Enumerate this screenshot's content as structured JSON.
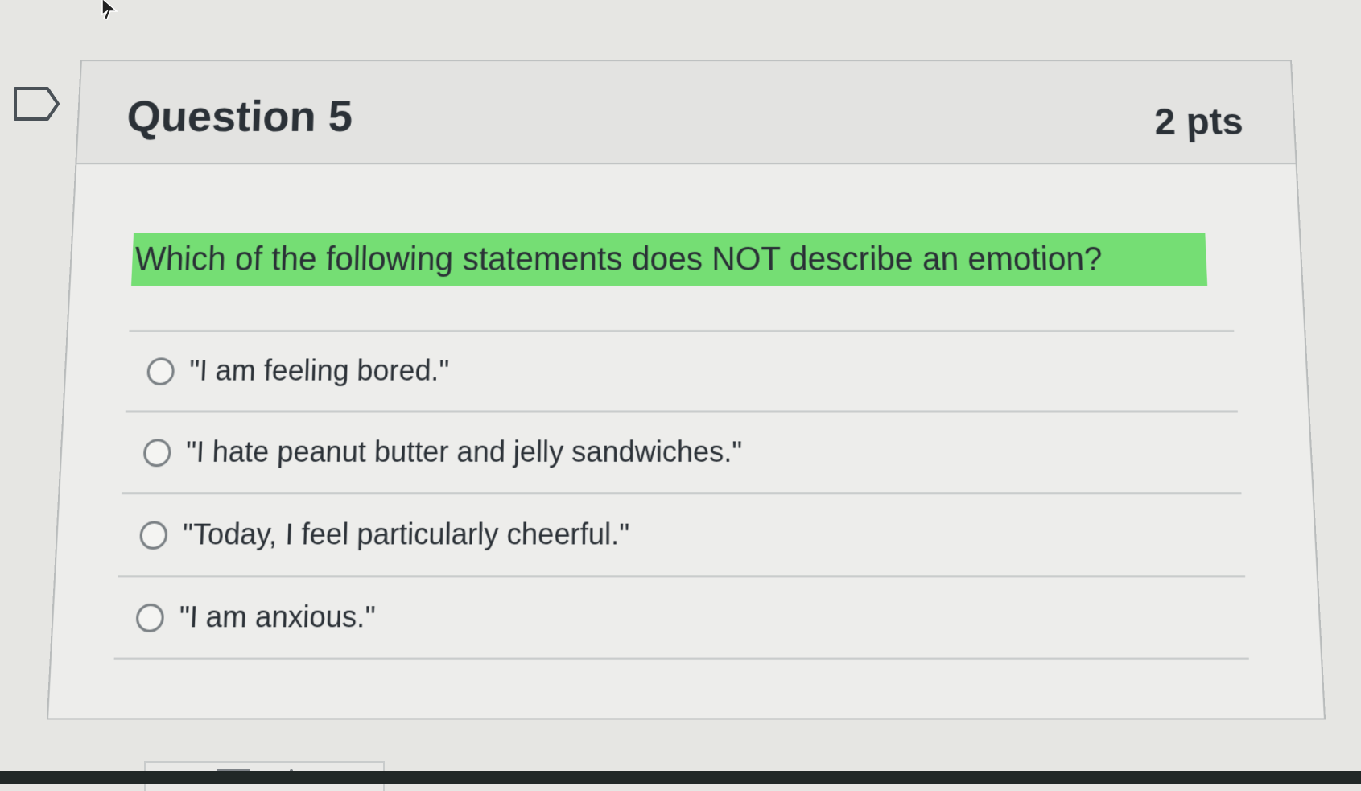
{
  "question": {
    "title": "Question 5",
    "points": "2 pts",
    "prompt": "Which of the following statements does NOT describe an emotion?",
    "highlight_color": "#75de74",
    "answers": [
      "\"I am feeling bored.\"",
      "\"I hate peanut butter and jelly sandwiches.\"",
      "\"Today, I feel particularly cheerful.\"",
      "\"I am anxious.\""
    ]
  },
  "icons": {
    "flag": "flag-outline-icon",
    "cursor": "mouse-pointer-icon",
    "radio": "radio-button-icon"
  },
  "colors": {
    "background": "#e6e6e3",
    "card_border": "#b9bcbc",
    "text": "#2b3137"
  }
}
